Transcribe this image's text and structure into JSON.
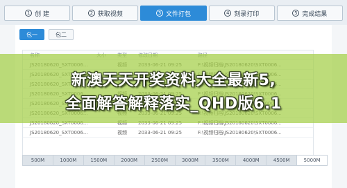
{
  "steps": [
    {
      "num": "1",
      "label": "创 建"
    },
    {
      "num": "2",
      "label": "获取视频"
    },
    {
      "num": "3",
      "label": "文件打包"
    },
    {
      "num": "4",
      "label": "刻录打印"
    },
    {
      "num": "5",
      "label": "完成结果"
    }
  ],
  "active_step": 2,
  "tabs": [
    {
      "label": "包一"
    },
    {
      "label": "包二"
    }
  ],
  "table": {
    "headers": [
      "名称",
      "大小",
      "类型",
      "修改日期",
      "路径"
    ],
    "rows": [
      [
        "JS20180620_SXT0006...",
        "",
        "视频",
        "2033-06-21 09:25",
        "F:\\视频归档\\JS20180620\\SXT0006..."
      ],
      [
        "JS20180620_SXT0006...",
        "",
        "视频",
        "2033-06-21 09:25",
        "F:\\视频归档\\JS20180620\\SXT0006..."
      ],
      [
        "JS20180620_SXT0006...",
        "",
        "视频",
        "2033-06-21 09:25",
        "F:\\视频归档\\JS20180620\\SXT0006..."
      ],
      [
        "JS20180620_SXT0006...",
        "",
        "视频",
        "2033-06-21 09:25",
        "F:\\视频归档\\JS20180620\\SXT0006..."
      ],
      [
        "JS20180620_SXT0006...",
        "",
        "视频",
        "2033-06-21 09:25",
        "F:\\视频归档\\JS20180620\\SXT0006..."
      ],
      [
        "JS20180620_SXT0006...",
        "",
        "视频",
        "2033-06-21 09:25",
        "F:\\视频归档\\JS20180620\\SXT0006..."
      ],
      [
        "JS20180620_SXT0006...",
        "",
        "视频",
        "2033-06-21 09:25",
        "F:\\视频归档\\JS20180620\\SXT0006..."
      ],
      [
        "JS20180620_SXT0006...",
        "",
        "视频",
        "2033-06-21 09:25",
        "F:\\视频归档\\JS20180620\\SXT0006..."
      ]
    ]
  },
  "size_scale": [
    "500M",
    "1000M",
    "1500M",
    "2000M",
    "2500M",
    "3000M",
    "3500M",
    "4000M",
    "4500M",
    "5000M"
  ],
  "overlay": {
    "line1": "新澳天天开奖资料大全最新5,",
    "line2": "全面解答解释落实_QHD版6.1"
  },
  "colors": {
    "accent": "#2d8bd8",
    "band": "#a3cf46"
  }
}
